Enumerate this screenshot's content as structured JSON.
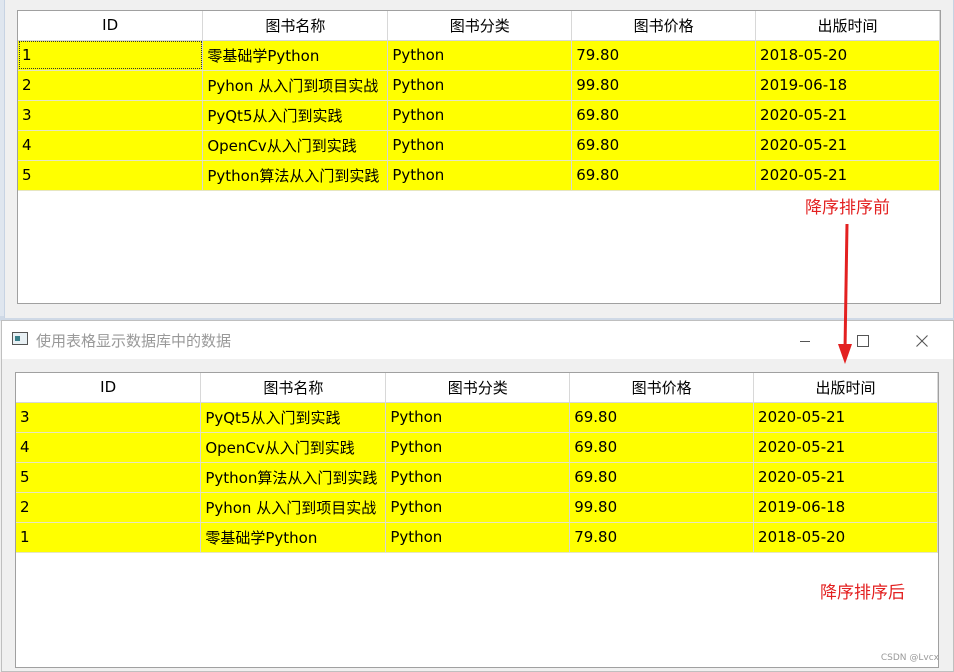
{
  "headers": [
    "ID",
    "图书名称",
    "图书分类",
    "图书价格",
    "出版时间"
  ],
  "before": {
    "rows": [
      [
        "1",
        "零基础学Python",
        "Python",
        "79.80",
        "2018-05-20"
      ],
      [
        "2",
        "Pyhon 从入门到项目实战",
        "Python",
        "99.80",
        "2019-06-18"
      ],
      [
        "3",
        "PyQt5从入门到实践",
        "Python",
        "69.80",
        "2020-05-21"
      ],
      [
        "4",
        "OpenCv从入门到实践",
        "Python",
        "69.80",
        "2020-05-21"
      ],
      [
        "5",
        "Python算法从入门到实践",
        "Python",
        "69.80",
        "2020-05-21"
      ]
    ]
  },
  "after": {
    "window_title": "使用表格显示数据库中的数据",
    "rows": [
      [
        "3",
        "PyQt5从入门到实践",
        "Python",
        "69.80",
        "2020-05-21"
      ],
      [
        "4",
        "OpenCv从入门到实践",
        "Python",
        "69.80",
        "2020-05-21"
      ],
      [
        "5",
        "Python算法从入门到实践",
        "Python",
        "69.80",
        "2020-05-21"
      ],
      [
        "2",
        "Pyhon 从入门到项目实战",
        "Python",
        "99.80",
        "2019-06-18"
      ],
      [
        "1",
        "零基础学Python",
        "Python",
        "79.80",
        "2018-05-20"
      ]
    ]
  },
  "annotations": {
    "before_label": "降序排序前",
    "after_label": "降序排序后"
  },
  "watermark": "CSDN @Lvcx",
  "colors": {
    "row_highlight": "#ffff00",
    "annotation": "#e32020"
  }
}
